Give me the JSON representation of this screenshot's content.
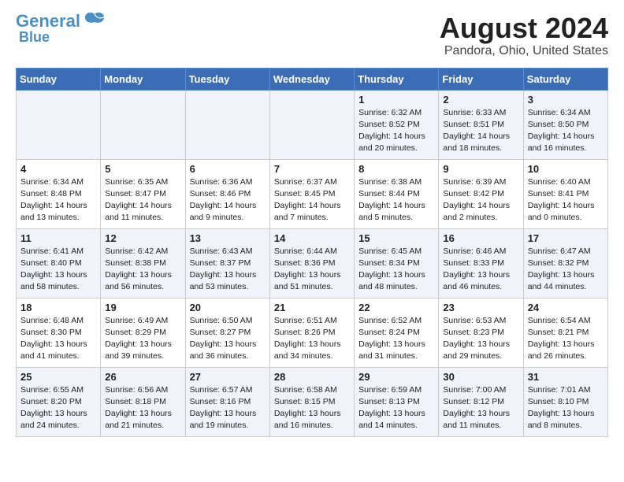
{
  "logo": {
    "line1": "General",
    "line2": "Blue"
  },
  "title": "August 2024",
  "subtitle": "Pandora, Ohio, United States",
  "days_of_week": [
    "Sunday",
    "Monday",
    "Tuesday",
    "Wednesday",
    "Thursday",
    "Friday",
    "Saturday"
  ],
  "weeks": [
    [
      {
        "num": "",
        "info": ""
      },
      {
        "num": "",
        "info": ""
      },
      {
        "num": "",
        "info": ""
      },
      {
        "num": "",
        "info": ""
      },
      {
        "num": "1",
        "info": "Sunrise: 6:32 AM\nSunset: 8:52 PM\nDaylight: 14 hours and 20 minutes."
      },
      {
        "num": "2",
        "info": "Sunrise: 6:33 AM\nSunset: 8:51 PM\nDaylight: 14 hours and 18 minutes."
      },
      {
        "num": "3",
        "info": "Sunrise: 6:34 AM\nSunset: 8:50 PM\nDaylight: 14 hours and 16 minutes."
      }
    ],
    [
      {
        "num": "4",
        "info": "Sunrise: 6:34 AM\nSunset: 8:48 PM\nDaylight: 14 hours and 13 minutes."
      },
      {
        "num": "5",
        "info": "Sunrise: 6:35 AM\nSunset: 8:47 PM\nDaylight: 14 hours and 11 minutes."
      },
      {
        "num": "6",
        "info": "Sunrise: 6:36 AM\nSunset: 8:46 PM\nDaylight: 14 hours and 9 minutes."
      },
      {
        "num": "7",
        "info": "Sunrise: 6:37 AM\nSunset: 8:45 PM\nDaylight: 14 hours and 7 minutes."
      },
      {
        "num": "8",
        "info": "Sunrise: 6:38 AM\nSunset: 8:44 PM\nDaylight: 14 hours and 5 minutes."
      },
      {
        "num": "9",
        "info": "Sunrise: 6:39 AM\nSunset: 8:42 PM\nDaylight: 14 hours and 2 minutes."
      },
      {
        "num": "10",
        "info": "Sunrise: 6:40 AM\nSunset: 8:41 PM\nDaylight: 14 hours and 0 minutes."
      }
    ],
    [
      {
        "num": "11",
        "info": "Sunrise: 6:41 AM\nSunset: 8:40 PM\nDaylight: 13 hours and 58 minutes."
      },
      {
        "num": "12",
        "info": "Sunrise: 6:42 AM\nSunset: 8:38 PM\nDaylight: 13 hours and 56 minutes."
      },
      {
        "num": "13",
        "info": "Sunrise: 6:43 AM\nSunset: 8:37 PM\nDaylight: 13 hours and 53 minutes."
      },
      {
        "num": "14",
        "info": "Sunrise: 6:44 AM\nSunset: 8:36 PM\nDaylight: 13 hours and 51 minutes."
      },
      {
        "num": "15",
        "info": "Sunrise: 6:45 AM\nSunset: 8:34 PM\nDaylight: 13 hours and 48 minutes."
      },
      {
        "num": "16",
        "info": "Sunrise: 6:46 AM\nSunset: 8:33 PM\nDaylight: 13 hours and 46 minutes."
      },
      {
        "num": "17",
        "info": "Sunrise: 6:47 AM\nSunset: 8:32 PM\nDaylight: 13 hours and 44 minutes."
      }
    ],
    [
      {
        "num": "18",
        "info": "Sunrise: 6:48 AM\nSunset: 8:30 PM\nDaylight: 13 hours and 41 minutes."
      },
      {
        "num": "19",
        "info": "Sunrise: 6:49 AM\nSunset: 8:29 PM\nDaylight: 13 hours and 39 minutes."
      },
      {
        "num": "20",
        "info": "Sunrise: 6:50 AM\nSunset: 8:27 PM\nDaylight: 13 hours and 36 minutes."
      },
      {
        "num": "21",
        "info": "Sunrise: 6:51 AM\nSunset: 8:26 PM\nDaylight: 13 hours and 34 minutes."
      },
      {
        "num": "22",
        "info": "Sunrise: 6:52 AM\nSunset: 8:24 PM\nDaylight: 13 hours and 31 minutes."
      },
      {
        "num": "23",
        "info": "Sunrise: 6:53 AM\nSunset: 8:23 PM\nDaylight: 13 hours and 29 minutes."
      },
      {
        "num": "24",
        "info": "Sunrise: 6:54 AM\nSunset: 8:21 PM\nDaylight: 13 hours and 26 minutes."
      }
    ],
    [
      {
        "num": "25",
        "info": "Sunrise: 6:55 AM\nSunset: 8:20 PM\nDaylight: 13 hours and 24 minutes."
      },
      {
        "num": "26",
        "info": "Sunrise: 6:56 AM\nSunset: 8:18 PM\nDaylight: 13 hours and 21 minutes."
      },
      {
        "num": "27",
        "info": "Sunrise: 6:57 AM\nSunset: 8:16 PM\nDaylight: 13 hours and 19 minutes."
      },
      {
        "num": "28",
        "info": "Sunrise: 6:58 AM\nSunset: 8:15 PM\nDaylight: 13 hours and 16 minutes."
      },
      {
        "num": "29",
        "info": "Sunrise: 6:59 AM\nSunset: 8:13 PM\nDaylight: 13 hours and 14 minutes."
      },
      {
        "num": "30",
        "info": "Sunrise: 7:00 AM\nSunset: 8:12 PM\nDaylight: 13 hours and 11 minutes."
      },
      {
        "num": "31",
        "info": "Sunrise: 7:01 AM\nSunset: 8:10 PM\nDaylight: 13 hours and 8 minutes."
      }
    ]
  ]
}
